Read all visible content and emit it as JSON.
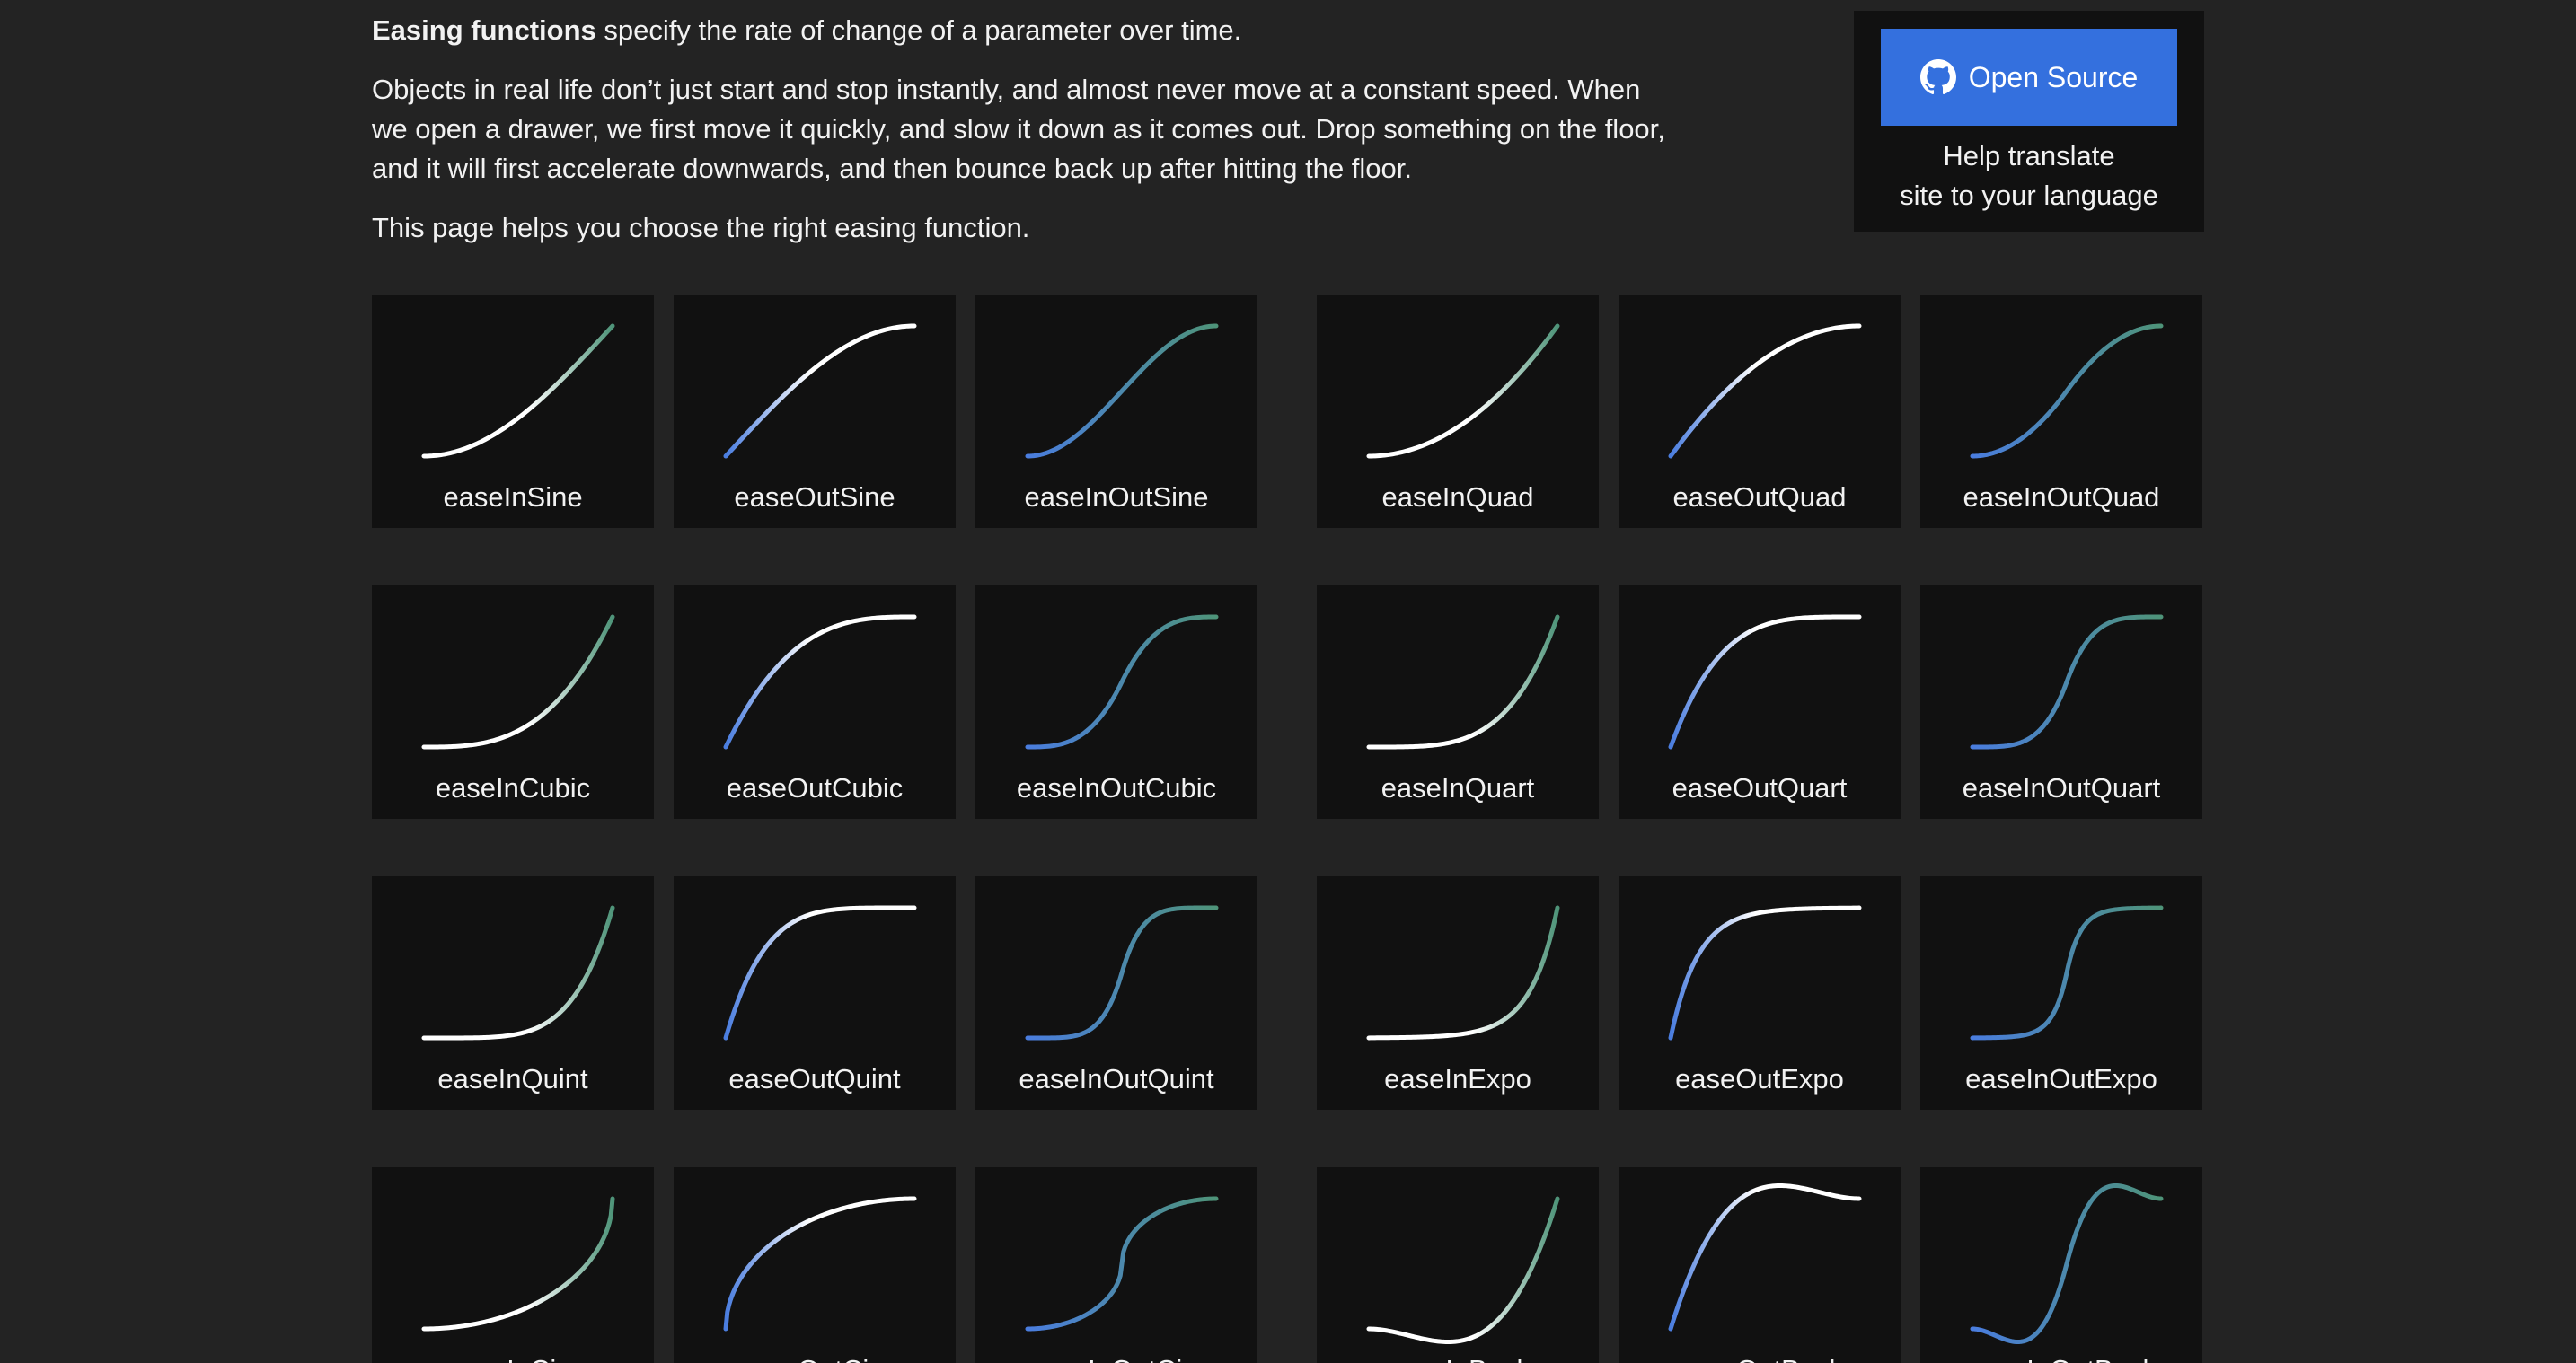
{
  "intro": {
    "bold": "Easing functions",
    "line1_rest": " specify the rate of change of a parameter over time.",
    "paragraph2": "Objects in real life don’t just start and stop instantly, and almost never move at a constant speed. When we open a drawer, we first move it quickly, and slow it down as it comes out. Drop something on the floor, and it will first accelerate downwards, and then bounce back up after hitting the floor.",
    "paragraph3": "This page helps you choose the right easing function."
  },
  "open_source": {
    "button_label": "Open Source",
    "icon": "github-icon",
    "help_line1": "Help translate",
    "help_line2": "site to your language"
  },
  "colors": {
    "background": "#232323",
    "card": "#111111",
    "button": "#3470de",
    "curve_blue": "#4a7ddf",
    "curve_green": "#4e9479",
    "curve_white": "#ffffff"
  },
  "easings": [
    {
      "name": "easeInSine"
    },
    {
      "name": "easeOutSine"
    },
    {
      "name": "easeInOutSine"
    },
    {
      "name": "easeInQuad"
    },
    {
      "name": "easeOutQuad"
    },
    {
      "name": "easeInOutQuad"
    },
    {
      "name": "easeInCubic"
    },
    {
      "name": "easeOutCubic"
    },
    {
      "name": "easeInOutCubic"
    },
    {
      "name": "easeInQuart"
    },
    {
      "name": "easeOutQuart"
    },
    {
      "name": "easeInOutQuart"
    },
    {
      "name": "easeInQuint"
    },
    {
      "name": "easeOutQuint"
    },
    {
      "name": "easeInOutQuint"
    },
    {
      "name": "easeInExpo"
    },
    {
      "name": "easeOutExpo"
    },
    {
      "name": "easeInOutExpo"
    },
    {
      "name": "easeInCirc"
    },
    {
      "name": "easeOutCirc"
    },
    {
      "name": "easeInOutCirc"
    },
    {
      "name": "easeInBack"
    },
    {
      "name": "easeOutBack"
    },
    {
      "name": "easeInOutBack"
    }
  ]
}
